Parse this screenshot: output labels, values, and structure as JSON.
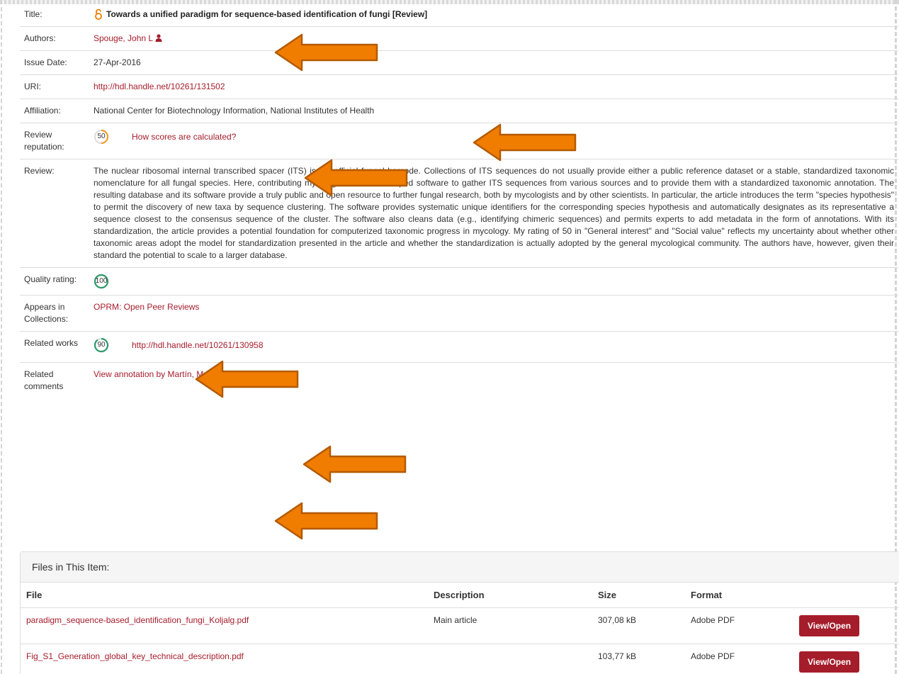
{
  "metadata": {
    "title_label": "Title:",
    "title_value": "Towards a unified paradigm for sequence-based identification of fungi [Review]",
    "authors_label": "Authors:",
    "authors_value": "Spouge, John L",
    "issue_label": "Issue Date:",
    "issue_value": "27-Apr-2016",
    "uri_label": "URI:",
    "uri_value": "http://hdl.handle.net/10261/131502",
    "affiliation_label": "Affiliation:",
    "affiliation_value": "National Center for Biotechnology Information, National Institutes of Health",
    "review_rep_label": "Review reputation:",
    "review_rep_score": "50",
    "review_rep_fraction": 0.5,
    "review_rep_color": "#f0a030",
    "review_rep_link": "How scores are calculated?",
    "review_label": "Review:",
    "review_text": "The nuclear ribosomal internal transcribed spacer (ITS) is the official fungal barcode. Collections of ITS sequences do not usually provide either a public reference dataset or a stable, standardized taxonomic nomenclature for all fungal species. Here, contributing mycologists have developed software to gather ITS sequences from various sources and to provide them with a standardized taxonomic annotation. The resulting database and its software provide a truly public and open resource to further fungal research, both by mycologists and by other scientists. In particular, the article introduces the term \"species hypothesis\" to permit the discovery of new taxa by sequence clustering. The software provides systematic unique identifiers for the corresponding species hypothesis and automatically designates as its representative a sequence closest to the consensus sequence of the cluster. The software also cleans data (e.g., identifying chimeric sequences) and permits experts to add metadata in the form of annotations. With its standardization, the article provides a potential foundation for computerized taxonomic progress in mycology. My rating of 50 in \"General interest\" and \"Social value\" reflects my uncertainty about whether other taxonomic areas adopt the model for standardization presented in the article and whether the standardization is actually adopted by the general mycological community. The authors have, however, given their standard the potential to scale to a larger database.",
    "quality_label": "Quality rating:",
    "quality_score": "100",
    "quality_fraction": 1.0,
    "quality_color": "#2e9a6a",
    "collections_label": "Appears in Collections:",
    "collections_value": "OPRM: Open Peer Reviews",
    "related_works_label": "Related works",
    "related_works_score": "90",
    "related_works_fraction": 0.9,
    "related_works_color": "#2e9a6a",
    "related_works_link": "http://hdl.handle.net/10261/130958",
    "related_comments_label": "Related comments",
    "related_comments_link": "View annotation by Martín, María P."
  },
  "files": {
    "heading": "Files in This Item:",
    "columns": [
      "File",
      "Description",
      "Size",
      "Format"
    ],
    "rows": [
      {
        "file": "paradigm_sequence-based_identification_fungi_Koljalg.pdf",
        "description": "Main article",
        "size": "307,08 kB",
        "format": "Adobe PDF",
        "button": "View/Open"
      },
      {
        "file": "Fig_S1_Generation_global_key_technical_description.pdf",
        "description": "",
        "size": "103,77 kB",
        "format": "Adobe PDF",
        "button": "View/Open"
      }
    ]
  },
  "colors": {
    "link": "#a51d2b",
    "arrow_fill": "#f07c00",
    "arrow_stroke": "#b35a00",
    "button": "#a51d2b"
  }
}
